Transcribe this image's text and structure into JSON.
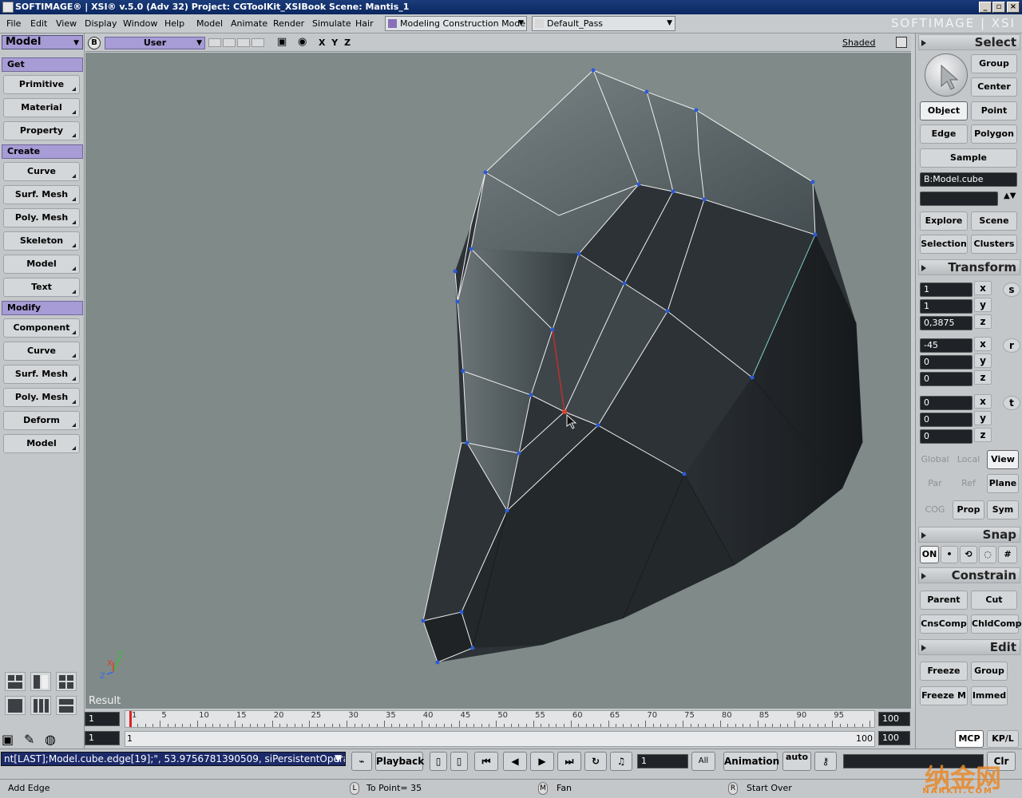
{
  "window": {
    "title": "SOFTIMAGE® | XSI® v.5.0 (Adv 32) Project: CGToolKit_XSIBook     Scene: Mantis_1",
    "controls": [
      "_",
      "▫",
      "×"
    ]
  },
  "menu": {
    "items": [
      "File",
      "Edit",
      "View",
      "Display",
      "Window",
      "Help"
    ],
    "modules": [
      "Model",
      "Animate",
      "Render",
      "Simulate",
      "Hair"
    ],
    "construction_mode": "Modeling Construction Mode",
    "pass": "Default_Pass",
    "brand": "SOFTIMAGE | XSI"
  },
  "left_panel": {
    "module": "Model",
    "sections": [
      {
        "header": "Get",
        "buttons": [
          "Primitive",
          "Material",
          "Property"
        ]
      },
      {
        "header": "Create",
        "buttons": [
          "Curve",
          "Surf. Mesh",
          "Poly. Mesh",
          "Skeleton",
          "Model",
          "Text"
        ]
      },
      {
        "header": "Modify",
        "buttons": [
          "Component",
          "Curve",
          "Surf. Mesh",
          "Poly. Mesh",
          "Deform",
          "Model"
        ]
      }
    ]
  },
  "viewport": {
    "toolbar_b": "B",
    "camera": "User",
    "axes": "X Y Z",
    "display_mode": "Shaded",
    "label": "Result",
    "mesh_color": "#2c3035",
    "background": "#7f8a89",
    "gizmo": {
      "x": "X",
      "y": "Y",
      "z": "Z"
    }
  },
  "right_panel": {
    "select": {
      "header": "Select",
      "group": "Group",
      "center": "Center",
      "object": "Object",
      "point": "Point",
      "edge": "Edge",
      "polygon": "Polygon",
      "sample": "Sample",
      "selection_field": "B:Model.cube",
      "explore": "Explore",
      "scene": "Scene",
      "selection": "Selection",
      "clusters": "Clusters"
    },
    "transform": {
      "header": "Transform",
      "scale": [
        "1",
        "1",
        "0,3875"
      ],
      "rotate": [
        "-45",
        "0",
        "0"
      ],
      "translate": [
        "0",
        "0",
        "0"
      ],
      "axis_labels": [
        "x",
        "y",
        "z"
      ],
      "s": "s",
      "r": "r",
      "t": "t",
      "ref": [
        "Global",
        "Local",
        "View",
        "Par",
        "Ref",
        "Plane",
        "COG",
        "Prop",
        "Sym"
      ]
    },
    "snap": {
      "header": "Snap",
      "on": "ON"
    },
    "constrain": {
      "header": "Constrain",
      "buttons": [
        "Parent",
        "Cut",
        "CnsComp",
        "ChldComp"
      ]
    },
    "edit": {
      "header": "Edit",
      "buttons": [
        "Freeze",
        "Group",
        "Freeze M",
        "Immed"
      ]
    }
  },
  "timeline": {
    "start": "1",
    "current": "1",
    "end": "100",
    "end2": "100",
    "range_end": "100",
    "ticks": [
      "1",
      "5",
      "10",
      "15",
      "20",
      "25",
      "30",
      "35",
      "40",
      "45",
      "50",
      "55",
      "60",
      "65",
      "70",
      "75",
      "80",
      "85",
      "90",
      "95"
    ],
    "lower_start": "1"
  },
  "playback": {
    "command": "nt[LAST];Model.cube.edge[19];\", 53.9756781390509, siPersistentOperation",
    "playback": "Playback",
    "frame": "1",
    "all": "All",
    "animation": "Animation",
    "auto": "auto",
    "mcp": "MCP",
    "kpl": "KP/L",
    "clr": "Clr"
  },
  "status": {
    "tool": "Add Edge",
    "left": "L",
    "left_text": "To Point= 35",
    "middle": "M",
    "middle_text": "Fan",
    "right": "R",
    "right_text": "Start Over"
  },
  "watermark": {
    "text": "纳金网",
    "sub": "NARKII.COM"
  }
}
